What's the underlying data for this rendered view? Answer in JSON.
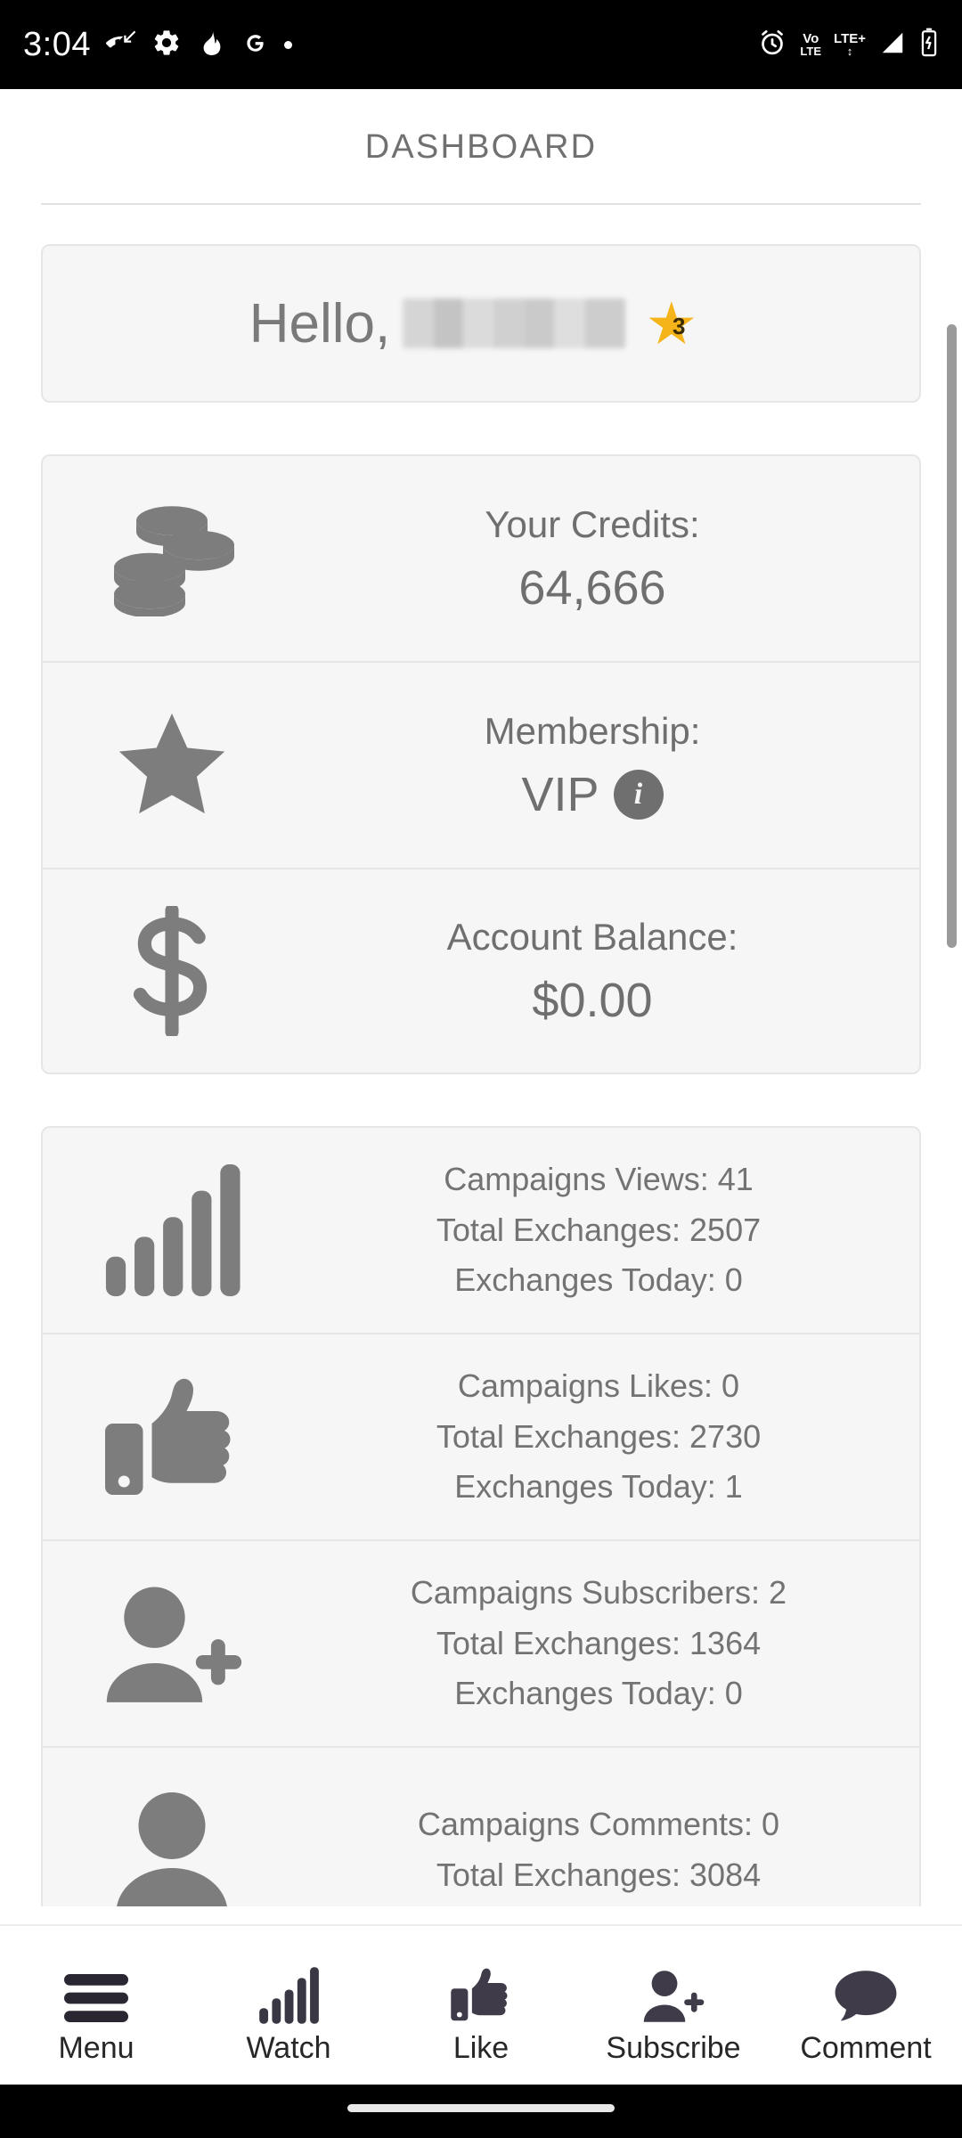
{
  "status_bar": {
    "time": "3:04",
    "left_icons": [
      "missed-call-icon",
      "settings-gear-icon",
      "flame-icon",
      "google-g-icon",
      "dot-icon"
    ],
    "right_icons": [
      "alarm-clock-icon",
      "volte-icon",
      "lte-plus-icon",
      "signal-bars-icon",
      "battery-charging-icon"
    ],
    "volte_label": "Vo",
    "volte_sub": "LTE",
    "lte_label": "LTE+"
  },
  "header": {
    "title": "DASHBOARD"
  },
  "greeting": {
    "hello_text": "Hello,",
    "username": "",
    "star_icon": "gold-star-icon",
    "star_level": "3"
  },
  "info_cards": [
    {
      "icon": "coins-stack-icon",
      "label": "Your Credits:",
      "value": "64,666",
      "has_info": false
    },
    {
      "icon": "star-icon",
      "label": "Membership:",
      "value": "VIP",
      "has_info": true,
      "info_glyph": "i"
    },
    {
      "icon": "dollar-sign-icon",
      "label": "Account Balance:",
      "value": "$0.00",
      "has_info": false
    }
  ],
  "stat_cards": [
    {
      "icon": "bar-chart-icon",
      "lines": [
        "Campaigns Views: 41",
        "Total Exchanges: 2507",
        "Exchanges Today: 0"
      ]
    },
    {
      "icon": "thumbs-up-icon",
      "lines": [
        "Campaigns Likes: 0",
        "Total Exchanges: 2730",
        "Exchanges Today: 1"
      ]
    },
    {
      "icon": "person-add-icon",
      "lines": [
        "Campaigns Subscribers: 2",
        "Total Exchanges: 1364",
        "Exchanges Today: 0"
      ]
    },
    {
      "icon": "person-icon",
      "lines": [
        "Campaigns Comments: 0",
        "Total Exchanges: 3084",
        ""
      ]
    }
  ],
  "bottom_nav": [
    {
      "icon": "hamburger-menu-icon",
      "label": "Menu"
    },
    {
      "icon": "bar-chart-icon",
      "label": "Watch"
    },
    {
      "icon": "thumbs-up-icon",
      "label": "Like"
    },
    {
      "icon": "person-add-icon",
      "label": "Subscribe"
    },
    {
      "icon": "comment-bubble-icon",
      "label": "Comment"
    }
  ],
  "colors": {
    "gray_text": "#6f6f6f",
    "card_bg": "#f6f6f6",
    "card_border": "#e6e6e6",
    "star_gold": "#f4b41a",
    "nav_dark": "#34303c"
  }
}
